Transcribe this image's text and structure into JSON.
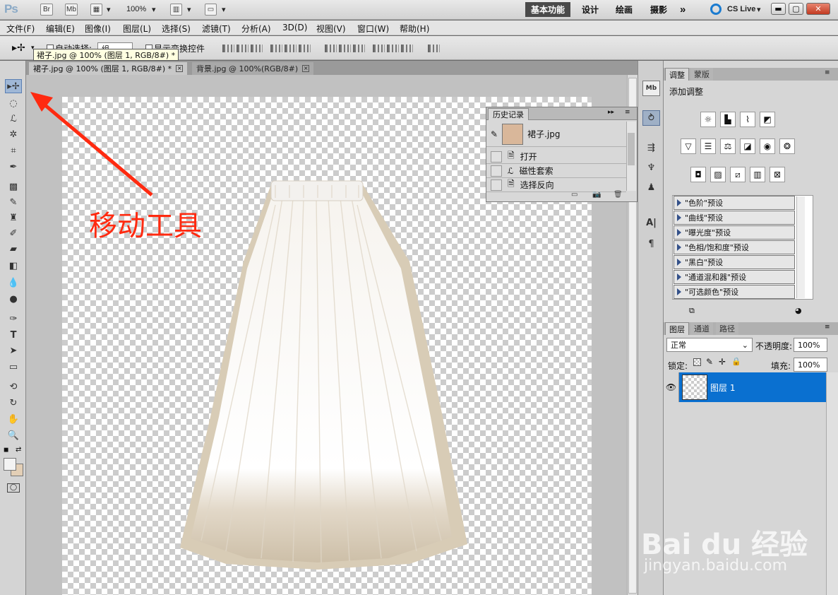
{
  "appbar": {
    "logo": "Ps",
    "bridge_label": "Br",
    "minibridge_label": "Mb",
    "zoom": "100%",
    "workspaces": [
      "基本功能",
      "设计",
      "绘画",
      "摄影"
    ],
    "more": "»",
    "cslive": "CS Live"
  },
  "menu": [
    "文件(F)",
    "编辑(E)",
    "图像(I)",
    "图层(L)",
    "选择(S)",
    "滤镜(T)",
    "分析(A)",
    "3D(D)",
    "视图(V)",
    "窗口(W)",
    "帮助(H)"
  ],
  "options": {
    "auto_select": "自动选择:",
    "auto_select_value": "组",
    "show_transform": "显示变换控件"
  },
  "tooltip": "裙子.jpg @ 100% (图层 1, RGB/8#) *",
  "tabs": [
    {
      "label": "裙子.jpg @ 100% (图层 1, RGB/8#) *",
      "close": "×"
    },
    {
      "label": "背景.jpg @ 100%(RGB/8#)",
      "close": "×"
    }
  ],
  "annotation": {
    "text": "移动工具",
    "color": "#ff2a10"
  },
  "history": {
    "title": "历史记录",
    "snapshot": "裙子.jpg",
    "steps": [
      "打开",
      "磁性套索",
      "选择反向"
    ]
  },
  "adjustments": {
    "tab_active": "调整",
    "tab_inactive": "蒙版",
    "heading": "添加调整",
    "presets": [
      "\"色阶\"预设",
      "\"曲线\"预设",
      "\"曝光度\"预设",
      "\"色相/饱和度\"预设",
      "\"黑白\"预设",
      "\"通道混和器\"预设",
      "\"可选颜色\"预设"
    ]
  },
  "layers": {
    "tabs": [
      "图层",
      "通道",
      "路径"
    ],
    "blend_mode": "正常",
    "opacity_label": "不透明度:",
    "opacity": "100%",
    "lock_label": "锁定:",
    "fill_label": "填充:",
    "fill": "100%",
    "layer_name": "图层 1"
  },
  "watermark": {
    "brand": "Bai du 经验",
    "url": "jingyan.baidu.com"
  },
  "colors": {
    "accent": "#0a70d0",
    "selection": "#0a70d0"
  }
}
